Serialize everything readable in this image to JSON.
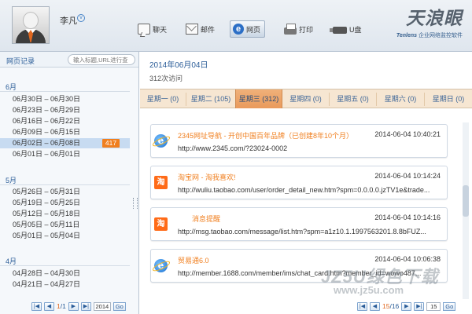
{
  "user": {
    "name": "李凡",
    "dropdown_icon": "chevron-down-icon"
  },
  "toolbar": {
    "items": [
      {
        "label": "聊天",
        "icon": "chat-icon"
      },
      {
        "label": "邮件",
        "icon": "mail-icon"
      },
      {
        "label": "网页",
        "icon": "ie-icon"
      },
      {
        "label": "打印",
        "icon": "printer-icon"
      },
      {
        "label": "U盘",
        "icon": "usb-icon"
      }
    ],
    "active": "网页"
  },
  "brand": {
    "name": "天浪眼",
    "tagline_en": "Tenlens",
    "tagline_zh": "企业网络监控软件"
  },
  "left": {
    "title": "网页记录",
    "search_placeholder": "输入标题,URL进行查",
    "groups": [
      {
        "month": "6月",
        "weeks": [
          "06月30日 – 06月30日",
          "06月23日 – 06月29日",
          "06月16日 – 06月22日",
          "06月09日 – 06月15日",
          "06月02日 – 06月08日",
          "06月01日 – 06月01日"
        ]
      },
      {
        "month": "5月",
        "weeks": [
          "05月26日 – 05月31日",
          "05月19日 – 05月25日",
          "05月12日 – 05月18日",
          "05月05日 – 05月11日",
          "05月01日 – 05月04日"
        ]
      },
      {
        "month": "4月",
        "weeks": [
          "04月28日 – 04月30日",
          "04月21日 – 04月27日"
        ]
      }
    ],
    "selected_badge": "417",
    "pager": {
      "current": "1",
      "total": "/1",
      "year": "2014",
      "go": "Go"
    }
  },
  "right": {
    "date": "2014年06月04日",
    "visits": "312次访问",
    "tabs": [
      "星期一 (0)",
      "星期二 (105)",
      "星期三 (312)",
      "星期四 (0)",
      "星期五 (0)",
      "星期六 (0)",
      "星期日 (0)"
    ],
    "active_tab": "星期三 (312)",
    "entries": [
      {
        "icon": "ie-icon",
        "title": "2345网址导航 - 开创中国百年品牌（已创建8年10个月）",
        "time": "2014-06-04 10:40:21",
        "url": "http://www.2345.com/?23024-0002"
      },
      {
        "icon": "taobao-icon",
        "title": "淘宝网 - 淘我喜欢!",
        "time": "2014-06-04 10:14:24",
        "url": "http://wuliu.taobao.com/user/order_detail_new.htm?spm=0.0.0.0.jzTV1e&trade..."
      },
      {
        "icon": "taobao-icon",
        "title": "消息提醒",
        "time": "2014-06-04 10:14:16",
        "url": "http://msg.taobao.com/message/list.htm?spm=a1z10.1.1997563201.8.8bFUZ..."
      },
      {
        "icon": "ie-icon",
        "title": "贸易通6.0",
        "time": "2014-06-04 10:06:38",
        "url": "http://member.1688.com/member/ims/chat_card.htm?member_id=wowo487..."
      }
    ],
    "pager": {
      "current": "15",
      "total": "/16",
      "page_input": "15",
      "go": "Go"
    }
  },
  "watermark": {
    "line1": "JZ5U绿色下载",
    "line2": "www.jz5u.com"
  },
  "taobao_glyph": "淘"
}
